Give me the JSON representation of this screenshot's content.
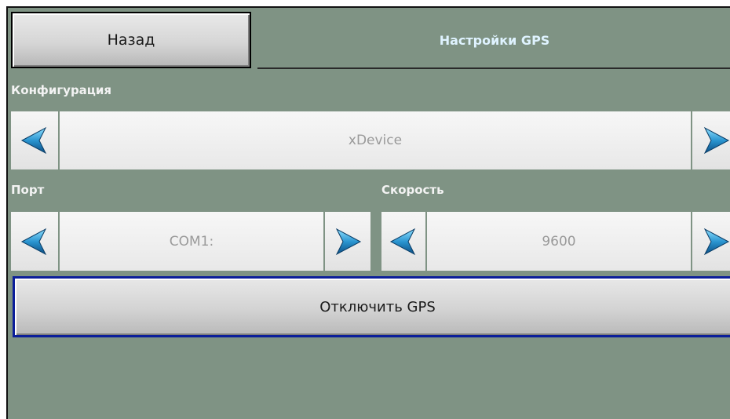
{
  "header": {
    "back_label": "Назад",
    "title": "Настройки GPS"
  },
  "configuration": {
    "label": "Конфигурация",
    "value": "xDevice"
  },
  "port": {
    "label": "Порт",
    "value": "COM1:"
  },
  "speed": {
    "label": "Скорость",
    "value": "9600"
  },
  "actions": {
    "disable_gps_label": "Отключить GPS"
  },
  "icons": {
    "prev": "arrow-left-icon",
    "next": "arrow-right-icon"
  },
  "colors": {
    "background": "#7f9384",
    "title": "#dff3ff",
    "arrow": "#2a8fc8",
    "focus_border": "#0b1e9a"
  }
}
